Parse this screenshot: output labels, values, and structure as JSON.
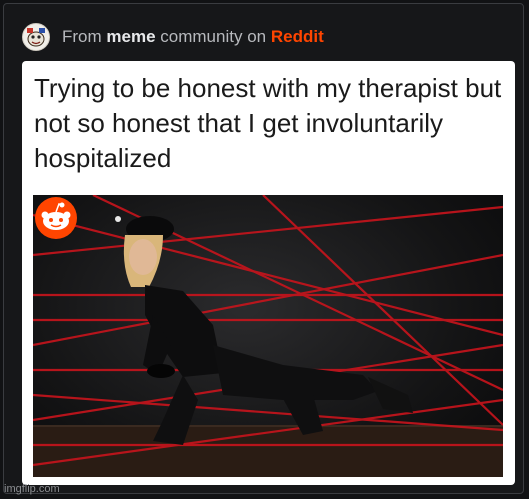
{
  "header": {
    "from": "From",
    "community": "meme",
    "middle": "community on",
    "platform": "Reddit"
  },
  "post": {
    "caption": "Trying to be honest with my therapist but not so honest that I get involuntarily hospitalized"
  },
  "photo": {
    "alt_icon": "reddit-snoo-icon"
  },
  "watermark": "imgflip.com",
  "colors": {
    "reddit_orange": "#ff4500",
    "background": "#111214",
    "laser_red": "#c8141c"
  }
}
